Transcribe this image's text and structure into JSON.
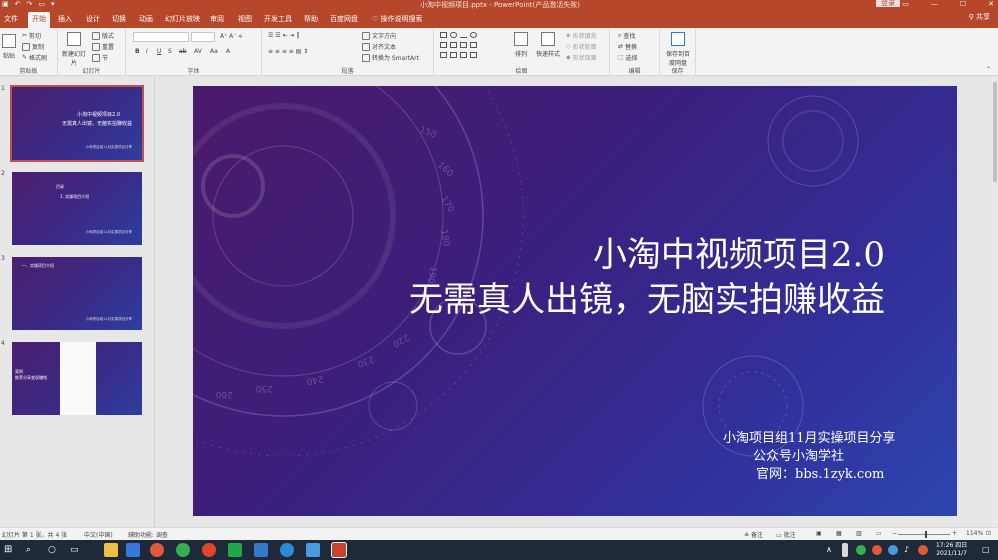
{
  "titlebar": {
    "doc_title": "小淘中视频项目.pptx  -  PowerPoint(产品激活失败)",
    "signin": "登录"
  },
  "tabs": [
    "文件",
    "开始",
    "插入",
    "设计",
    "切换",
    "动画",
    "幻灯片放映",
    "审阅",
    "视图",
    "开发工具",
    "帮助",
    "百度网盘"
  ],
  "tell_me": "操作说明搜索",
  "share": "共享",
  "ribbon": {
    "clipboard": {
      "label": "剪贴板",
      "paste": "粘贴",
      "cut": "剪切",
      "copy": "复制",
      "painter": "格式刷"
    },
    "slides": {
      "label": "幻灯片",
      "new_slide": "新建幻灯片",
      "layout": "版式",
      "reset": "重置",
      "section": "节"
    },
    "font": {
      "label": "字体"
    },
    "paragraph": {
      "label": "段落",
      "text_dir": "文字方向",
      "align_text": "对齐文本",
      "smartart": "转换为 SmartArt"
    },
    "drawing": {
      "label": "绘图",
      "arrange": "排列",
      "quick_styles": "快速样式",
      "fill": "形状填充",
      "outline": "形状轮廓",
      "effects": "形状效果"
    },
    "editing": {
      "label": "编辑",
      "find": "查找",
      "replace": "替换",
      "select": "选择"
    },
    "save": {
      "label": "保存",
      "save_baidu": "保存到百度网盘"
    }
  },
  "thumbnails": [
    {
      "num": "1",
      "line1": "小淘中视频项目2.0",
      "line2": "无需真人出镜，无脑实拍赚收益"
    },
    {
      "num": "2",
      "line1": "目录",
      "line2": "1. 实操项目介绍"
    },
    {
      "num": "3",
      "line1": "一、实操项目介绍",
      "line2": ""
    },
    {
      "num": "4",
      "line1": "案例",
      "line2": "推荐分享变现赚钱"
    }
  ],
  "slide": {
    "title_line1": "小淘中视频项目2.0",
    "title_line2": "无需真人出镜，无脑实拍赚收益",
    "sub1": "小淘项目组11月实操项目分享",
    "sub2": "公众号小淘学社",
    "sub3": "官网：bbs.1zyk.com"
  },
  "statusbar": {
    "slide_info": "幻灯片 第 1 张，共 4 张",
    "lang": "中文(中国)",
    "accessibility": "辅助功能: 调查",
    "notes": "备注",
    "comments": "批注",
    "zoom": "114%"
  },
  "taskbar": {
    "time": "17:26 四日",
    "date": "2021/11/7"
  },
  "colors": {
    "accent": "#b7472a",
    "slide_bg_start": "#4a1a6a",
    "slide_bg_end": "#2c45b0"
  }
}
